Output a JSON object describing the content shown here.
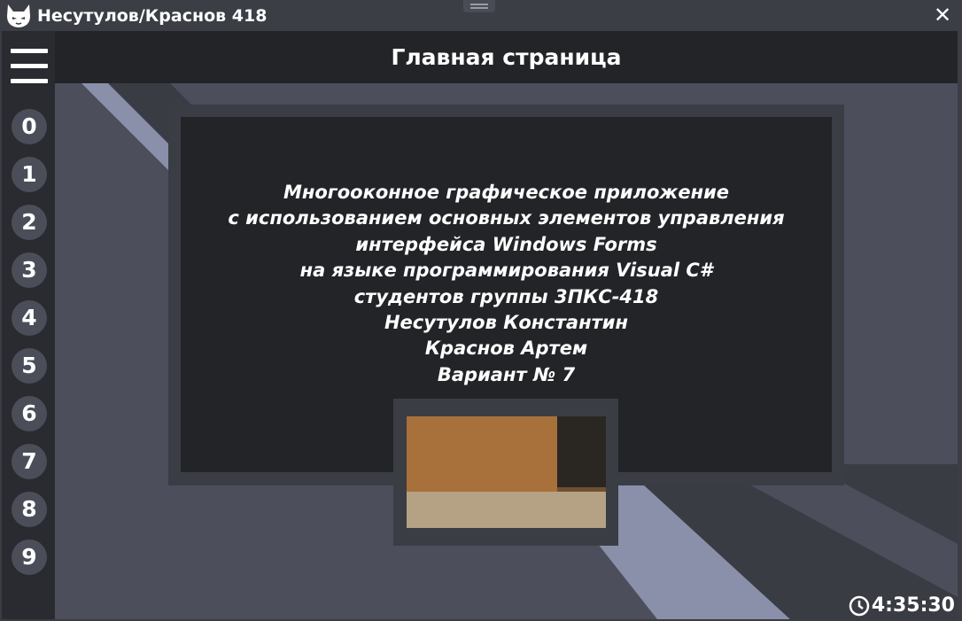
{
  "window": {
    "title": "Несутулов/Краснов 418",
    "icon": "cat-logo-icon",
    "close_glyph": "✕"
  },
  "header": {
    "title": "Главная страница"
  },
  "sidebar": {
    "menu_icon": "hamburger-menu-icon",
    "numbers": [
      "0",
      "1",
      "2",
      "3",
      "4",
      "5",
      "6",
      "7",
      "8",
      "9"
    ]
  },
  "main": {
    "lines": [
      "Многооконное графическое приложение",
      "с использованием основных элементов управления",
      "интерфейса Windows Forms",
      "на языке программирования Visual C#",
      "студентов группы 3ПКС-418",
      "Несутулов Константин",
      "Краснов Артем",
      "Вариант № 7"
    ],
    "image": "cat-photo"
  },
  "status": {
    "clock_icon": "clock-icon",
    "time": "4:35:30"
  },
  "colors": {
    "window_bg": "#3a3c44",
    "header_bg": "#232428",
    "sidebar_bg": "#2a2b30",
    "content_bg": "#4c4f5b",
    "stripe_light": "#8a90aa",
    "stripe_dark": "#3a3c44",
    "button_bg": "#4b4e58",
    "text": "#ffffff"
  }
}
